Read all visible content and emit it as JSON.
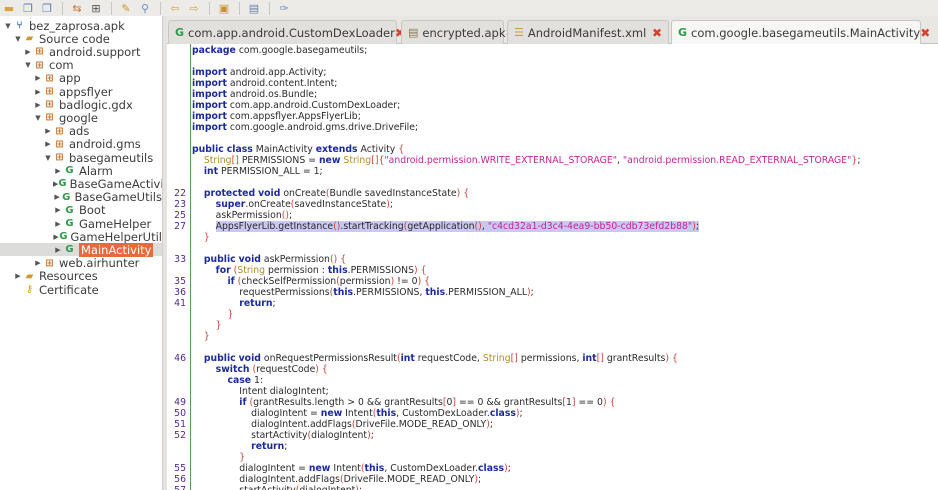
{
  "toolbar": {
    "icons": [
      "open-folder-icon",
      "save-all-icon",
      "export-icon",
      "sync-tree-icon",
      "flatten-packages-icon",
      "deobfuscate-wand-icon",
      "search-icon",
      "back-arrow-icon",
      "forward-arrow-icon",
      "search-class-icon",
      "log-viewer-icon",
      "preferences-wrench-icon"
    ]
  },
  "tree": [
    {
      "label": "bez_zaprosa.apk",
      "icon": "apk",
      "depth": 0,
      "arrow": "▼"
    },
    {
      "label": "Source code",
      "icon": "folder",
      "depth": 1,
      "arrow": "▼"
    },
    {
      "label": "android.support",
      "icon": "pkg",
      "depth": 2,
      "arrow": "▶"
    },
    {
      "label": "com",
      "icon": "pkg",
      "depth": 2,
      "arrow": "▼"
    },
    {
      "label": "app",
      "icon": "pkg",
      "depth": 3,
      "arrow": "▶"
    },
    {
      "label": "appsflyer",
      "icon": "pkg",
      "depth": 3,
      "arrow": "▶"
    },
    {
      "label": "badlogic.gdx",
      "icon": "pkg",
      "depth": 3,
      "arrow": "▶"
    },
    {
      "label": "google",
      "icon": "pkg",
      "depth": 3,
      "arrow": "▼"
    },
    {
      "label": "ads",
      "icon": "pkg",
      "depth": 4,
      "arrow": "▶"
    },
    {
      "label": "android.gms",
      "icon": "pkg",
      "depth": 4,
      "arrow": "▶"
    },
    {
      "label": "basegameutils",
      "icon": "pkg",
      "depth": 4,
      "arrow": "▼"
    },
    {
      "label": "Alarm",
      "icon": "cls",
      "depth": 5,
      "arrow": "▶"
    },
    {
      "label": "BaseGameActivi",
      "icon": "cls",
      "depth": 5,
      "arrow": "▶"
    },
    {
      "label": "BaseGameUtils",
      "icon": "cls",
      "depth": 5,
      "arrow": "▶"
    },
    {
      "label": "Boot",
      "icon": "cls",
      "depth": 5,
      "arrow": "▶"
    },
    {
      "label": "GameHelper",
      "icon": "cls",
      "depth": 5,
      "arrow": "▶"
    },
    {
      "label": "GameHelperUtil",
      "icon": "cls",
      "depth": 5,
      "arrow": "▶"
    },
    {
      "label": "MainActivity",
      "icon": "cls",
      "depth": 5,
      "arrow": "▶",
      "selected": true
    },
    {
      "label": "web.airhunter",
      "icon": "pkg",
      "depth": 3,
      "arrow": "▶"
    },
    {
      "label": "Resources",
      "icon": "folder",
      "depth": 1,
      "arrow": "▶"
    },
    {
      "label": "Certificate",
      "icon": "key",
      "depth": 1,
      "arrow": ""
    }
  ],
  "tabs": [
    {
      "label": "com.app.android.CustomDexLoader",
      "icon": "class-icon",
      "active": false
    },
    {
      "label": "encrypted.apk",
      "icon": "file-icon",
      "active": false
    },
    {
      "label": "AndroidManifest.xml",
      "icon": "xml-icon",
      "active": false
    },
    {
      "label": "com.google.basegameutils.MainActivity",
      "icon": "class-icon",
      "active": true
    }
  ],
  "colors": {
    "keyword": "#1b2a9c",
    "string": "#c4249a",
    "type": "#b58a2a",
    "selection": "#e8693a",
    "highlight": "#c8c8f0"
  },
  "code": [
    {
      "n": "",
      "text": "package com.google.basegameutils;"
    },
    {
      "n": "",
      "text": ""
    },
    {
      "n": "",
      "text": "import android.app.Activity;"
    },
    {
      "n": "",
      "text": "import android.content.Intent;"
    },
    {
      "n": "",
      "text": "import android.os.Bundle;"
    },
    {
      "n": "",
      "text": "import com.app.android.CustomDexLoader;"
    },
    {
      "n": "",
      "text": "import com.appsflyer.AppsFlyerLib;"
    },
    {
      "n": "",
      "text": "import com.google.android.gms.drive.DriveFile;"
    },
    {
      "n": "",
      "text": ""
    },
    {
      "n": "",
      "text": "public class MainActivity extends Activity {"
    },
    {
      "n": "",
      "text": "    String[] PERMISSIONS = new String[]{\"android.permission.WRITE_EXTERNAL_STORAGE\", \"android.permission.READ_EXTERNAL_STORAGE\"};"
    },
    {
      "n": "",
      "text": "    int PERMISSION_ALL = 1;"
    },
    {
      "n": "",
      "text": ""
    },
    {
      "n": "22",
      "text": "    protected void onCreate(Bundle savedInstanceState) {"
    },
    {
      "n": "23",
      "text": "        super.onCreate(savedInstanceState);"
    },
    {
      "n": "25",
      "text": "        askPermission();"
    },
    {
      "n": "27",
      "text": "        AppsFlyerLib.getInstance().startTracking(getApplication(), \"c4cd32a1-d3c4-4ea9-bb50-cdb73efd2b88\");",
      "highlight": true
    },
    {
      "n": "",
      "text": "    }"
    },
    {
      "n": "",
      "text": ""
    },
    {
      "n": "33",
      "text": "    public void askPermission() {"
    },
    {
      "n": "",
      "text": "        for (String permission : this.PERMISSIONS) {"
    },
    {
      "n": "35",
      "text": "            if (checkSelfPermission(permission) != 0) {"
    },
    {
      "n": "36",
      "text": "                requestPermissions(this.PERMISSIONS, this.PERMISSION_ALL);"
    },
    {
      "n": "41",
      "text": "                return;"
    },
    {
      "n": "",
      "text": "            }"
    },
    {
      "n": "",
      "text": "        }"
    },
    {
      "n": "",
      "text": "    }"
    },
    {
      "n": "",
      "text": ""
    },
    {
      "n": "46",
      "text": "    public void onRequestPermissionsResult(int requestCode, String[] permissions, int[] grantResults) {"
    },
    {
      "n": "",
      "text": "        switch (requestCode) {"
    },
    {
      "n": "",
      "text": "            case 1:"
    },
    {
      "n": "",
      "text": "                Intent dialogIntent;"
    },
    {
      "n": "49",
      "text": "                if (grantResults.length > 0 && grantResults[0] == 0 && grantResults[1] == 0) {"
    },
    {
      "n": "50",
      "text": "                    dialogIntent = new Intent(this, CustomDexLoader.class);"
    },
    {
      "n": "51",
      "text": "                    dialogIntent.addFlags(DriveFile.MODE_READ_ONLY);"
    },
    {
      "n": "52",
      "text": "                    startActivity(dialogIntent);"
    },
    {
      "n": "",
      "text": "                    return;"
    },
    {
      "n": "",
      "text": "                }"
    },
    {
      "n": "55",
      "text": "                dialogIntent = new Intent(this, CustomDexLoader.class);"
    },
    {
      "n": "56",
      "text": "                dialogIntent.addFlags(DriveFile.MODE_READ_ONLY);"
    },
    {
      "n": "57",
      "text": "                startActivity(dialogIntent);"
    }
  ]
}
